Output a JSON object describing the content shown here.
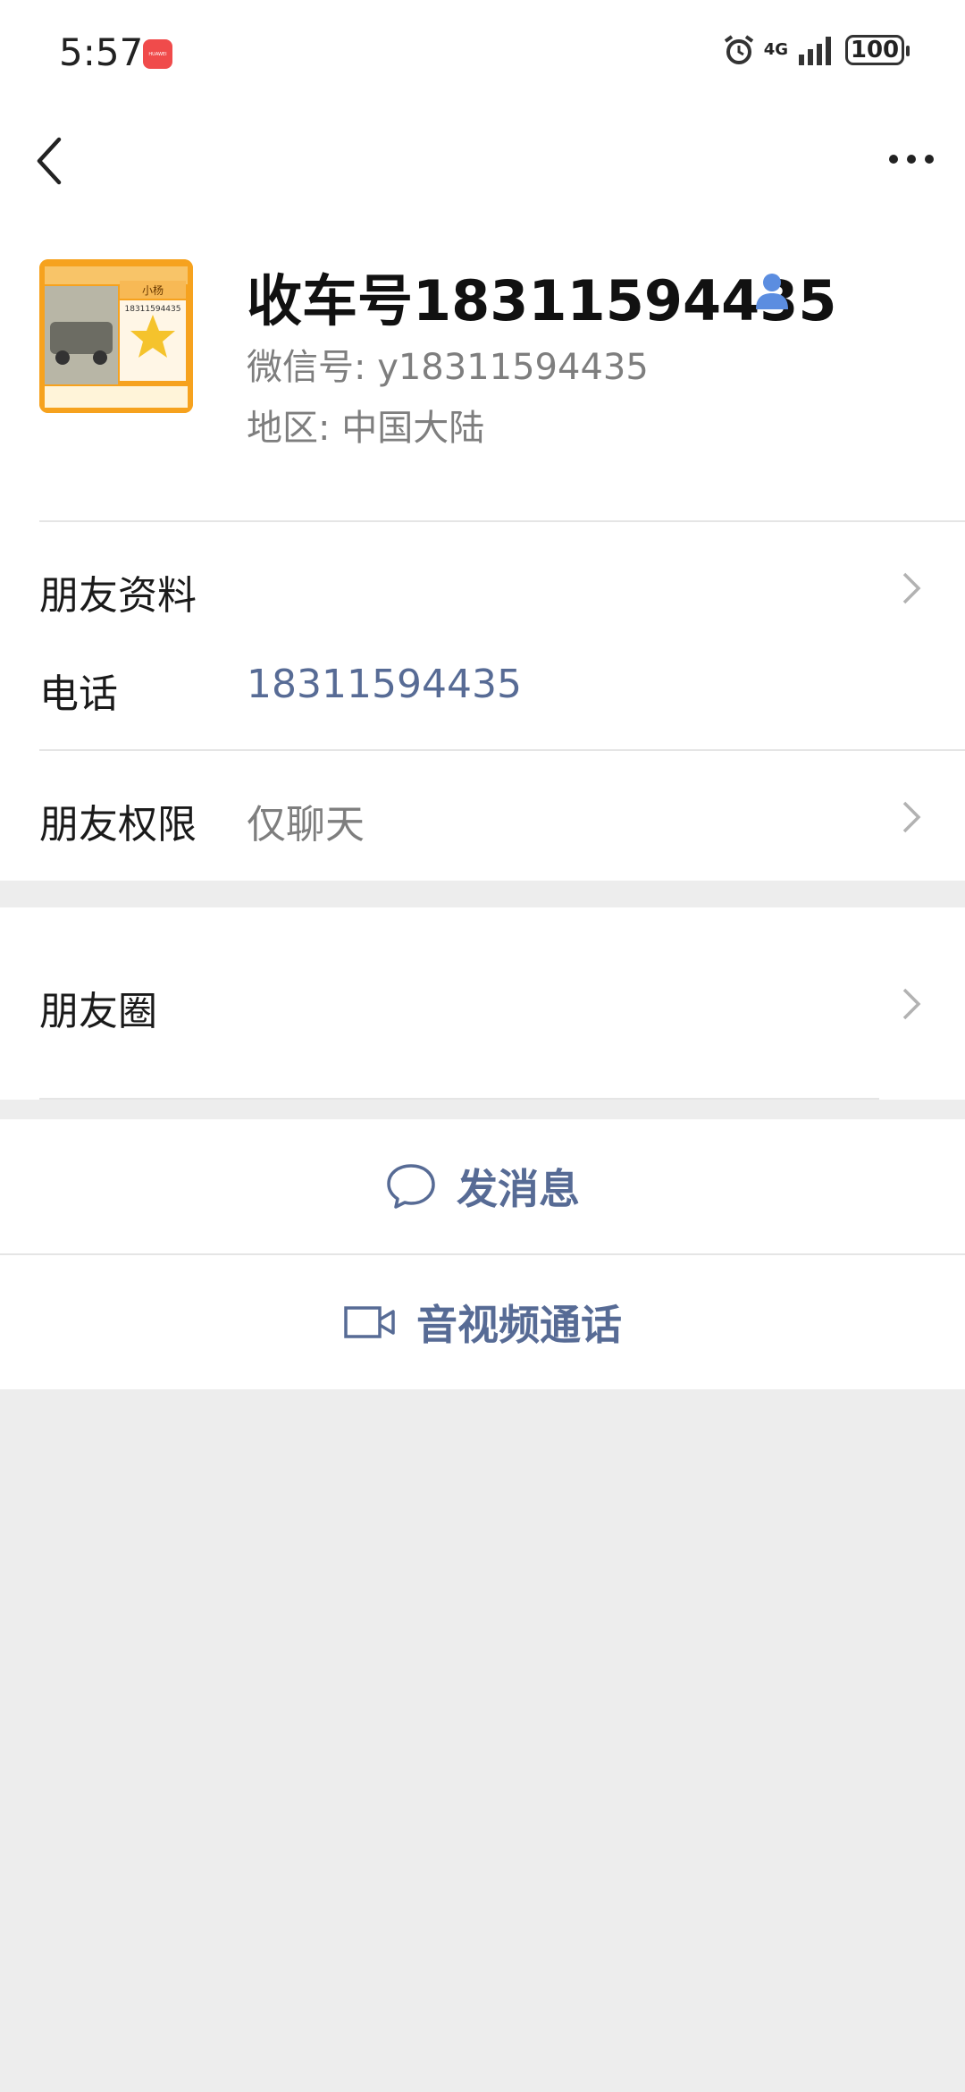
{
  "status_bar": {
    "time": "5:57",
    "network": "4G",
    "battery": "100"
  },
  "nav": {
    "back_icon": "back-arrow-icon",
    "more_icon": "more-icon"
  },
  "profile": {
    "name": "收车号18311594435",
    "wechat_id": "微信号: y18311594435",
    "region": "地区: 中国大陆"
  },
  "avatar_card": {
    "name": "小杨",
    "phone": "18311594435"
  },
  "rows": {
    "friend_info": "朋友资料",
    "phone_label": "电话",
    "phone_value": "18311594435",
    "permission_label": "朋友权限",
    "permission_value": "仅聊天",
    "moments_label": "朋友圈"
  },
  "actions": {
    "send_message": "发消息",
    "video_call": "音视频通话"
  },
  "colors": {
    "link_blue": "#576b95",
    "background": "#ededed",
    "avatar_orange": "#f6a21e"
  }
}
